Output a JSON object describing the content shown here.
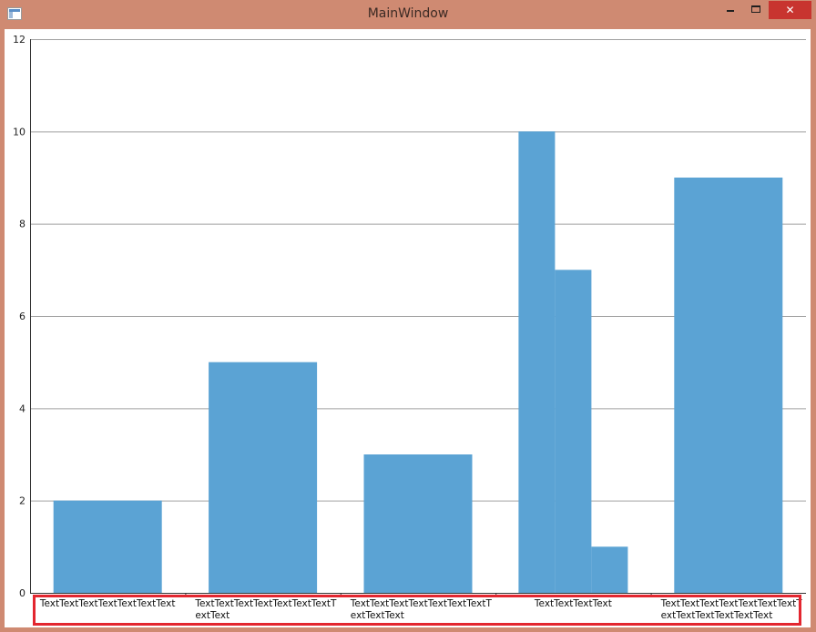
{
  "window": {
    "title": "MainWindow",
    "controls": {
      "minimize_icon": "minimize-icon",
      "maximize_icon": "maximize-icon",
      "close_icon": "close-icon",
      "close_glyph": "✕"
    }
  },
  "colors": {
    "titlebar": "#cf8a72",
    "bar": "#5ba3d4",
    "grid": "#a0a0a0",
    "highlight": "#e3262f",
    "close": "#c8342f"
  },
  "chart_data": {
    "type": "bar",
    "ylim": [
      0,
      12
    ],
    "yticks": [
      0,
      2,
      4,
      6,
      8,
      10,
      12
    ],
    "grid": true,
    "categories": [
      [
        "TextTextTextTextTextTextText"
      ],
      [
        "TextTextTextTextTextTextTextT",
        "extText"
      ],
      [
        "TextTextTextTextTextTextTextT",
        "extTextText"
      ],
      [
        "TextTextTextText"
      ],
      [
        "TextTextTextTextTextTextTextT",
        "extTextTextTextTextText"
      ]
    ],
    "values": [
      [
        2
      ],
      [
        5
      ],
      [
        3
      ],
      [
        10,
        7,
        1
      ],
      [
        9
      ]
    ]
  }
}
